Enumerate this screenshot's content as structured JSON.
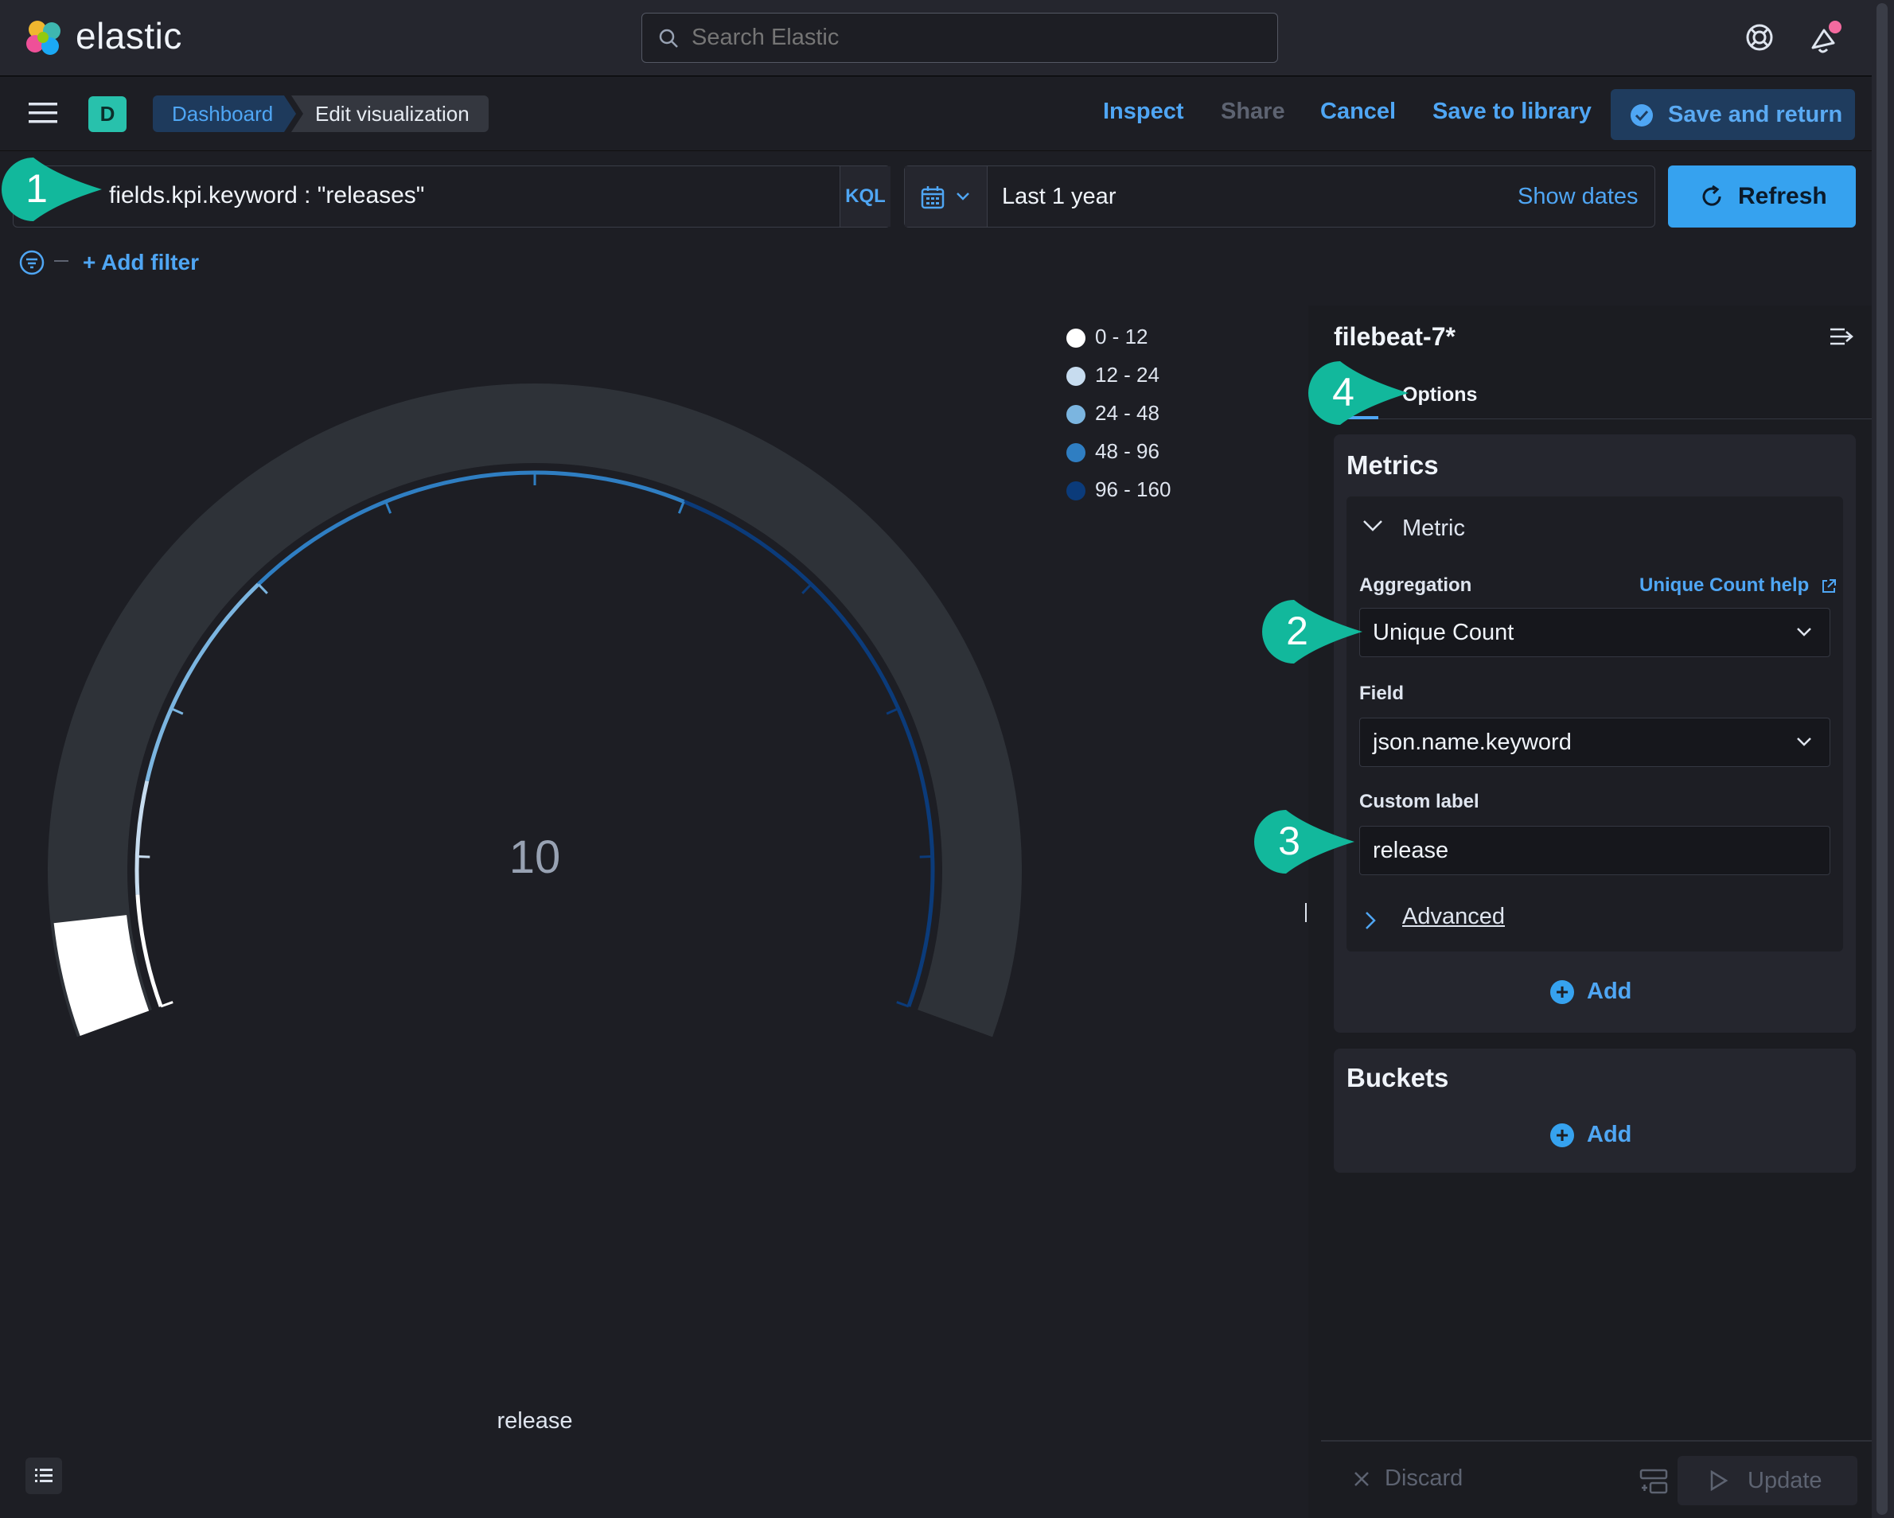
{
  "header": {
    "brand": "elastic",
    "search_placeholder": "Search Elastic"
  },
  "nav": {
    "space_initial": "D",
    "breadcrumbs": [
      "Dashboard",
      "Edit visualization"
    ],
    "inspect": "Inspect",
    "share": "Share",
    "cancel": "Cancel",
    "save_to_library": "Save to library",
    "save_and_return": "Save and return"
  },
  "query": {
    "text": "fields.kpi.keyword : \"releases\"",
    "language": "KQL"
  },
  "time": {
    "range": "Last 1 year",
    "show_dates": "Show dates",
    "refresh": "Refresh"
  },
  "filters": {
    "add_filter": "+ Add filter"
  },
  "chart_data": {
    "type": "gauge",
    "value": 10,
    "label": "release",
    "range": [
      0,
      160
    ],
    "legend": [
      {
        "label": "0 - 12",
        "color": "#ffffff"
      },
      {
        "label": "12 - 24",
        "color": "#c7dcef"
      },
      {
        "label": "24 - 48",
        "color": "#7bb5e0"
      },
      {
        "label": "48 - 96",
        "color": "#2f7ec2"
      },
      {
        "label": "96 - 160",
        "color": "#0b3b7a"
      }
    ]
  },
  "editor": {
    "index_pattern": "filebeat-7*",
    "tab_options": "Options",
    "metrics_title": "Metrics",
    "metric_name": "Metric",
    "aggregation_label": "Aggregation",
    "aggregation_help": "Unique Count help",
    "aggregation_value": "Unique Count",
    "field_label": "Field",
    "field_value": "json.name.keyword",
    "custom_label_label": "Custom label",
    "custom_label_value": "release",
    "advanced": "Advanced",
    "add": "Add",
    "buckets_title": "Buckets",
    "bucket_add": "Add",
    "discard": "Discard",
    "update": "Update"
  },
  "callouts": [
    "1",
    "2",
    "3",
    "4"
  ],
  "colors": {
    "accent": "#36a2ef",
    "callout": "#12b89c",
    "background": "#1d1e24"
  }
}
